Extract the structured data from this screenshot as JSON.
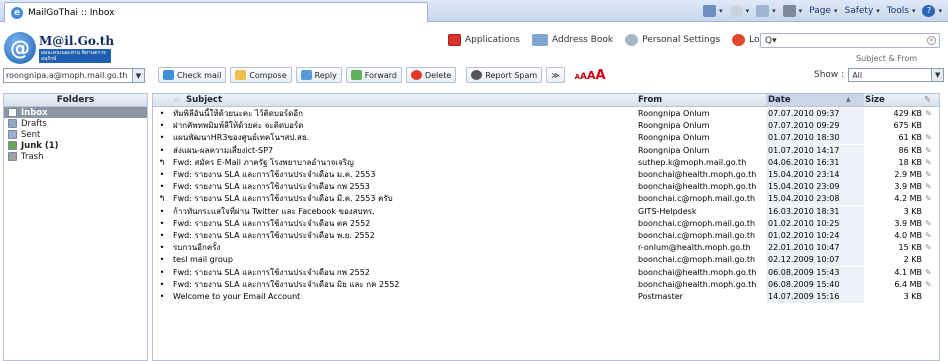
{
  "browser": {
    "tab_title": "MailGoThai :: Inbox",
    "commands": [
      "Page",
      "Safety",
      "Tools"
    ]
  },
  "logo": {
    "name": "M@il.Go.th",
    "tagline": "ผมจะคนเนสะพาน พิสานตรวจอนุรักษ์"
  },
  "toplinks": {
    "applications": "Applications",
    "address_book": "Address Book",
    "personal_settings": "Personal Settings",
    "logout": "Logout"
  },
  "search": {
    "placeholder": "Q▾",
    "scope": "Subject & From"
  },
  "identity": {
    "value": "roongnipa.a@moph.mail.go.th"
  },
  "toolbar": {
    "check_mail": "Check mail",
    "compose": "Compose",
    "reply": "Reply",
    "forward": "Forward",
    "delete": "Delete",
    "report_spam": "Report Spam",
    "more": "≫",
    "font_sizes": [
      "A",
      "A",
      "A",
      "A"
    ]
  },
  "show": {
    "label": "Show :",
    "value": "All"
  },
  "sidebar": {
    "header": "Folders",
    "items": [
      {
        "label": "Inbox",
        "selected": true,
        "bold": true,
        "color": "#ffffff"
      },
      {
        "label": "Drafts",
        "selected": false,
        "bold": false,
        "color": "#8fa6c8"
      },
      {
        "label": "Sent",
        "selected": false,
        "bold": false,
        "color": "#9ab0cc"
      },
      {
        "label": "Junk (1)",
        "selected": false,
        "bold": true,
        "color": "#6aa84f"
      },
      {
        "label": "Trash",
        "selected": false,
        "bold": false,
        "color": "#a0a0a0"
      }
    ]
  },
  "list": {
    "columns": {
      "subject": "Subject",
      "from": "From",
      "date": "Date",
      "size": "Size"
    },
    "rows": [
      {
        "flag": "•",
        "subject": "ทัมพิลีอันนี้ให้ด้วยนะคะ ไว้ติดบอร์ดอีก",
        "from": "Roongnipa Onlum",
        "date": "07.07.2010 09:37",
        "size": "429 KB",
        "att": "✎"
      },
      {
        "flag": "•",
        "subject": "ฝากคัพทพมิมพ์ลีให้ด้วยค่ะ จะติดบอร์ด",
        "from": "Roongnipa Onlum",
        "date": "07.07.2010 09:29",
        "size": "675 KB",
        "att": ""
      },
      {
        "flag": "•",
        "subject": "แผนพัฒนาHR3ของศูนย์เทคโนฯสป.สธ.",
        "from": "Roongnipa Onlum",
        "date": "01.07.2010 18:30",
        "size": "61 KB",
        "att": "✎"
      },
      {
        "flag": "•",
        "subject": "ส่งแผน-ผลความเสี่ยงict-SP7",
        "from": "Roongnipa Onlum",
        "date": "01.07.2010 14:17",
        "size": "86 KB",
        "att": "✎"
      },
      {
        "flag": "↰",
        "subject": "Fwd: สมัคร E-Mail ภาครัฐ โรงพยาบาลอำนาจเจริญ",
        "from": "suthep.k@moph.mail.go.th",
        "date": "04.06.2010 16:31",
        "size": "18 KB",
        "att": "✎"
      },
      {
        "flag": "•",
        "subject": "Fwd: รายงาน SLA และการใช้งานประจำเดือน ม.ค. 2553",
        "from": "boonchai@health.moph.go.th",
        "date": "15.04.2010 23:14",
        "size": "2.9 MB",
        "att": "✎"
      },
      {
        "flag": "•",
        "subject": "Fwd: รายงาน SLA และการใช้งานประจำเดือน กพ 2553",
        "from": "boonchai@health.moph.go.th",
        "date": "15.04.2010 23:09",
        "size": "3.9 MB",
        "att": "✎"
      },
      {
        "flag": "↰",
        "subject": "Fwd: รายงาน SLA และการใช้งานประจำเดือน มี.ค. 2553 ครับ",
        "from": "boonchai.c@moph.mail.go.th",
        "date": "15.04.2010 23:08",
        "size": "4.2 MB",
        "att": "✎"
      },
      {
        "flag": "•",
        "subject": "ก้าวทันกระแสใจที่ผ่าน Twitter และ Facebook ของสบทร.",
        "from": "GITS-Helpdesk",
        "date": "16.03.2010 18:31",
        "size": "3 KB",
        "att": ""
      },
      {
        "flag": "•",
        "subject": "Fwd: รายงาน SLA และการใช้งานประจำเดือน ตค 2552",
        "from": "boonchai.c@moph.mail.go.th",
        "date": "01.02.2010 10:25",
        "size": "3.9 MB",
        "att": "✎"
      },
      {
        "flag": "•",
        "subject": "Fwd: รายงาน SLA และการใช้งานประจำเดือน พ.ย. 2552",
        "from": "boonchai.c@moph.mail.go.th",
        "date": "01.02.2010 10:24",
        "size": "4.0 MB",
        "att": "✎"
      },
      {
        "flag": "•",
        "subject": "รบกวนอีกครั้ง",
        "from": "r-onlum@health.moph.go.th",
        "date": "22.01.2010 10:47",
        "size": "15 KB",
        "att": "✎"
      },
      {
        "flag": "•",
        "subject": "tesl mail group",
        "from": "boonchai.c@moph.mail.go.th",
        "date": "02.12.2009 10:07",
        "size": "2 KB",
        "att": ""
      },
      {
        "flag": "•",
        "subject": "Fwd: รายงาน SLA และการใช้งานประจำเดือน กพ 2552",
        "from": "boonchai@health.moph.go.th",
        "date": "06.08.2009 15:43",
        "size": "4.1 MB",
        "att": "✎"
      },
      {
        "flag": "•",
        "subject": "Fwd: รายงาน SLA และการใช้งานประจำเดือน มิย และ กค 2552",
        "from": "boonchai@health.moph.go.th",
        "date": "06.08.2009 15:40",
        "size": "6.4 MB",
        "att": "✎"
      },
      {
        "flag": "•",
        "subject": "Welcome to your Email Account",
        "from": "Postmaster",
        "date": "14.07.2009 15:16",
        "size": "3 KB",
        "att": ""
      }
    ]
  }
}
